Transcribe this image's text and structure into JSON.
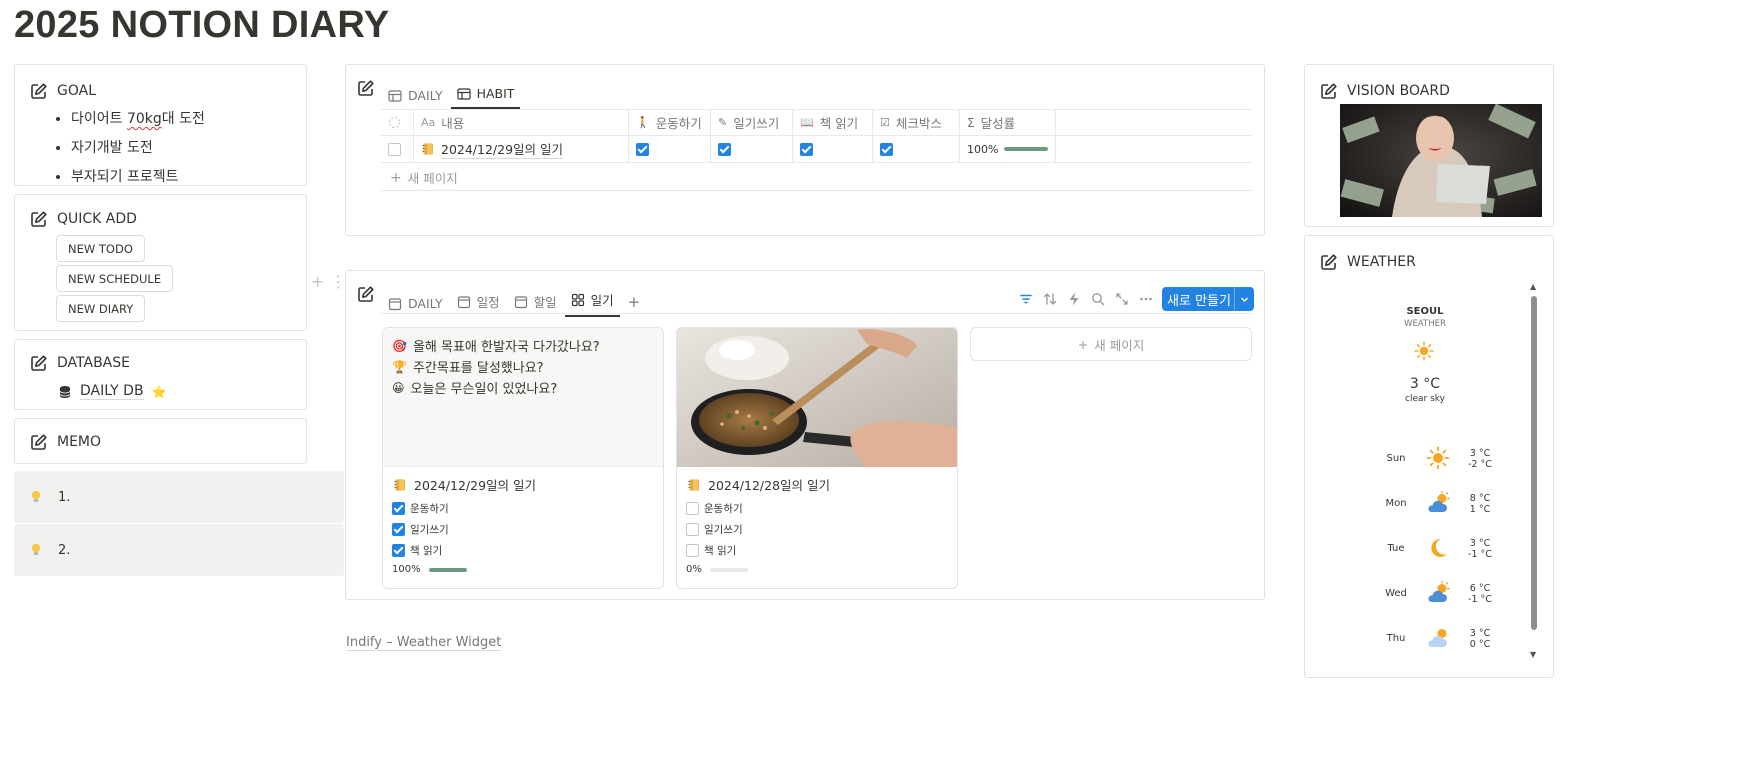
{
  "page": {
    "title": "2025 NOTION DIARY"
  },
  "goal": {
    "title": "GOAL",
    "items": [
      {
        "pre": "다이어트 ",
        "mark": "70kg",
        "post": "대 도전"
      },
      {
        "text": "자기개발 도전"
      },
      {
        "text": "부자되기 프로젝트"
      }
    ]
  },
  "quick_add": {
    "title": "QUICK ADD",
    "buttons": [
      "NEW TODO",
      "NEW SCHEDULE",
      "NEW DIARY"
    ]
  },
  "database": {
    "title": "DATABASE",
    "link": "DAILY DB",
    "star": "⭐"
  },
  "memo": {
    "title": "MEMO",
    "callouts": [
      "1.",
      "2."
    ]
  },
  "habit_view": {
    "tabs": [
      "DAILY",
      "HABIT"
    ],
    "active_tab": "HABIT",
    "columns": [
      "내용",
      "운동하기",
      "일기쓰기",
      "책 읽기",
      "체크박스",
      "달성률"
    ],
    "row": {
      "title": "2024/12/29일의 일기",
      "checks": [
        true,
        true,
        true,
        true
      ],
      "rate_text": "100%",
      "rate": 1.0
    },
    "new_page": "새 페이지"
  },
  "diary_view": {
    "tabs": [
      "DAILY",
      "일정",
      "할일",
      "일기"
    ],
    "active_tab": "일기",
    "new_button": "새로 만들기",
    "cards": [
      {
        "questions": [
          "올해 목표애 한발자국 다가갔나요?",
          "주간목표를 달성했나요?",
          "오늘은 무슨일이 있었나요?"
        ],
        "title": "2024/12/29일의 일기",
        "checks": [
          {
            "label": "운동하기",
            "on": true
          },
          {
            "label": "일기쓰기",
            "on": true
          },
          {
            "label": "책 읽기",
            "on": true
          }
        ],
        "progress_text": "100%",
        "progress": 1.0
      },
      {
        "title": "2024/12/28일의 일기",
        "checks": [
          {
            "label": "운동하기",
            "on": false
          },
          {
            "label": "일기쓰기",
            "on": false
          },
          {
            "label": "책 읽기",
            "on": false
          }
        ],
        "progress_text": "0%",
        "progress": 0.0
      }
    ],
    "new_page": "새 페이지"
  },
  "footer": {
    "link": "Indify – Weather Widget"
  },
  "vision_board": {
    "title": "VISION BOARD"
  },
  "weather": {
    "title": "WEATHER",
    "city": "SEOUL",
    "subtitle": "WEATHER",
    "temp": "3 °C",
    "desc": "clear sky",
    "forecast": [
      {
        "day": "Sun",
        "hi": "3 °C",
        "lo": "-2 °C",
        "icon": "sun-icon"
      },
      {
        "day": "Mon",
        "hi": "8 °C",
        "lo": "1 °C",
        "icon": "cloud-sun-icon"
      },
      {
        "day": "Tue",
        "hi": "3 °C",
        "lo": "-1 °C",
        "icon": "moon-icon"
      },
      {
        "day": "Wed",
        "hi": "6 °C",
        "lo": "-1 °C",
        "icon": "cloud-sun-icon"
      },
      {
        "day": "Thu",
        "hi": "3 °C",
        "lo": "0 °C",
        "icon": "light-cloud-sun-icon"
      }
    ]
  },
  "colors": {
    "accent": "#2383e2",
    "progress": "#6b9a7e",
    "callout_bg": "#f1f1ef",
    "sun": "#f6a623",
    "cloud": "#4d8fd6"
  }
}
